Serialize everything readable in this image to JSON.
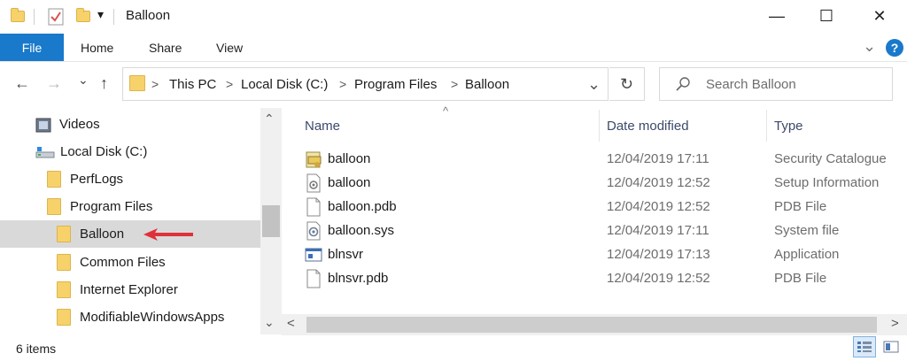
{
  "window": {
    "title": "Balloon",
    "minimize_glyph": "—",
    "maximize_glyph": "☐",
    "close_glyph": "✕"
  },
  "ribbon": {
    "tabs": [
      "File",
      "Home",
      "Share",
      "View"
    ],
    "expand_glyph": "⌄",
    "help_glyph": "?"
  },
  "nav": {
    "back_glyph": "←",
    "forward_glyph": "→",
    "recent_glyph": "⌄",
    "up_glyph": "↑",
    "refresh_glyph": "↻"
  },
  "address": {
    "crumbs": [
      "This PC",
      "Local Disk (C:)",
      "Program Files",
      "Balloon"
    ],
    "separator": ">",
    "dropdown_glyph": "⌄"
  },
  "search": {
    "placeholder": "Search Balloon"
  },
  "navpane": {
    "items": [
      {
        "label": "Videos",
        "icon": "videos-icon"
      },
      {
        "label": "Local Disk (C:)",
        "icon": "drive-icon"
      },
      {
        "label": "PerfLogs",
        "icon": "folder-icon"
      },
      {
        "label": "Program Files",
        "icon": "folder-icon"
      },
      {
        "label": "Balloon",
        "icon": "folder-icon",
        "selected": true
      },
      {
        "label": "Common Files",
        "icon": "folder-icon"
      },
      {
        "label": "Internet Explorer",
        "icon": "folder-icon"
      },
      {
        "label": "ModifiableWindowsApps",
        "icon": "folder-icon"
      }
    ],
    "scroll_up_glyph": "⌃",
    "scroll_down_glyph": "⌄"
  },
  "columns": {
    "name": "Name",
    "date": "Date modified",
    "type": "Type",
    "sort_glyph": "^"
  },
  "files": [
    {
      "name": "balloon",
      "date": "12/04/2019 17:11",
      "type": "Security Catalogue",
      "icon": "security-catalog-icon"
    },
    {
      "name": "balloon",
      "date": "12/04/2019 12:52",
      "type": "Setup Information",
      "icon": "setup-info-icon"
    },
    {
      "name": "balloon.pdb",
      "date": "12/04/2019 12:52",
      "type": "PDB File",
      "icon": "document-icon"
    },
    {
      "name": "balloon.sys",
      "date": "12/04/2019 17:11",
      "type": "System file",
      "icon": "system-file-icon"
    },
    {
      "name": "blnsvr",
      "date": "12/04/2019 17:13",
      "type": "Application",
      "icon": "application-icon"
    },
    {
      "name": "blnsvr.pdb",
      "date": "12/04/2019 12:52",
      "type": "PDB File",
      "icon": "document-icon"
    }
  ],
  "hscroll": {
    "left_glyph": "<",
    "right_glyph": ">"
  },
  "status": {
    "items_count": "6 items"
  },
  "colors": {
    "accent": "#1979ca",
    "arrow": "#e0313a",
    "selection": "#d9d9d9"
  }
}
